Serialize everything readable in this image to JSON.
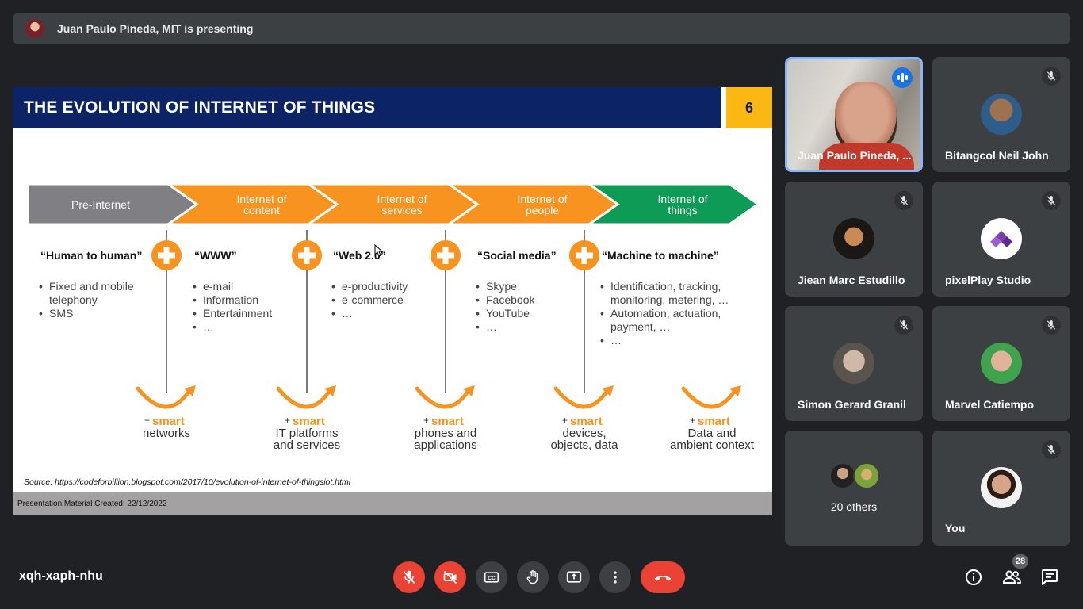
{
  "banner": {
    "text": "Juan Paulo Pineda, MIT is presenting"
  },
  "slide": {
    "title": "THE EVOLUTION OF INTERNET OF THINGS",
    "number": "6",
    "stages": [
      {
        "label_lines": [
          "Pre-Internet"
        ],
        "color": "#7f7f84",
        "heading": "“Human to human”",
        "bullets": [
          [
            "Fixed and mobile",
            "telephony"
          ],
          [
            "SMS"
          ]
        ]
      },
      {
        "label_lines": [
          "Internet of",
          "content"
        ],
        "color": "#f7931e",
        "heading": "“WWW”",
        "bullets": [
          [
            "e-mail"
          ],
          [
            "Information"
          ],
          [
            "Entertainment"
          ],
          [
            "…"
          ]
        ]
      },
      {
        "label_lines": [
          "Internet of",
          "services"
        ],
        "color": "#f7931e",
        "heading": "“Web 2.0”",
        "bullets": [
          [
            "e-productivity"
          ],
          [
            "e-commerce"
          ],
          [
            "…"
          ]
        ]
      },
      {
        "label_lines": [
          "Internet of",
          "people"
        ],
        "color": "#f7931e",
        "heading": "“Social media”",
        "bullets": [
          [
            "Skype"
          ],
          [
            "Facebook"
          ],
          [
            "YouTube"
          ],
          [
            "…"
          ]
        ]
      },
      {
        "label_lines": [
          "Internet of",
          "things"
        ],
        "color": "#0d9b55",
        "heading": "“Machine to machine”",
        "bullets": [
          [
            "Identification, tracking,",
            "monitoring, metering, …"
          ],
          [
            "Automation, actuation,",
            "payment, …"
          ],
          [
            "…"
          ]
        ]
      }
    ],
    "smart_prefix": "+",
    "smart_word": "smart",
    "smart_items": [
      [
        "networks"
      ],
      [
        "IT platforms",
        "and services"
      ],
      [
        "phones and",
        "applications"
      ],
      [
        "devices,",
        "objects, data"
      ],
      [
        "Data and",
        "ambient context"
      ]
    ],
    "source": "Source: https://codeforbillion.blogspot.com/2017/10/evolution-of-internet-of-thingsiot.html",
    "footer": "Presentation Material Created:   22/12/2022"
  },
  "participants": [
    {
      "name": "Juan Paulo Pineda, ...",
      "active": true
    },
    {
      "name": "Bitangcol Neil John"
    },
    {
      "name": "Jiean Marc Estudillo"
    },
    {
      "name": "pixelPlay Studio"
    },
    {
      "name": "Simon Gerard Granil"
    },
    {
      "name": "Marvel Catiempo"
    },
    {
      "name": "20 others"
    },
    {
      "name": "You"
    }
  ],
  "meeting": {
    "code": "xqh-xaph-nhu",
    "people_count": "28"
  },
  "colors": {
    "accent": "#8ab4f8",
    "end_call": "#ea4335",
    "slide_header": "#0c2466",
    "slide_number_bg": "#fbb813",
    "smart_orange": "#f7931e"
  }
}
